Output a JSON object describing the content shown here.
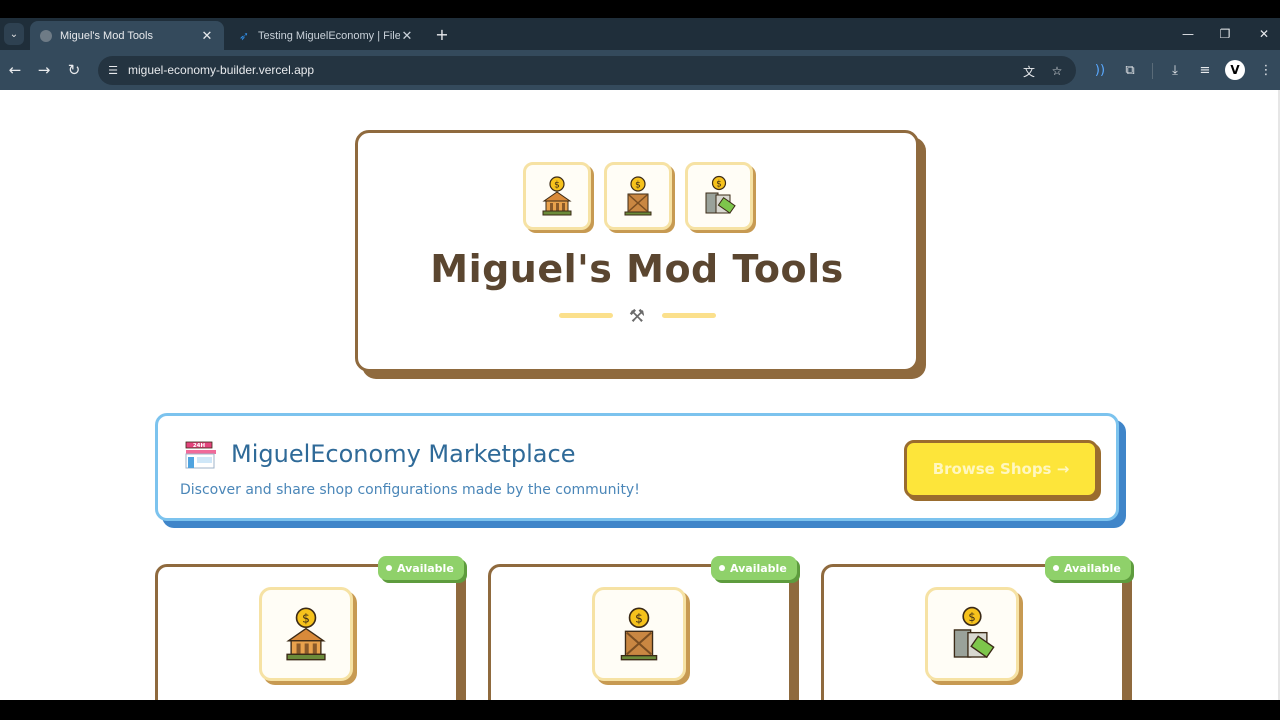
{
  "browser": {
    "tabs": [
      {
        "title": "Miguel's Mod Tools",
        "active": true
      },
      {
        "title": "Testing MiguelEconomy | File M",
        "active": false
      }
    ],
    "url": "miguel-economy-builder.vercel.app",
    "profile_initial": "V"
  },
  "hero": {
    "title": "Miguel's Mod Tools",
    "icons": [
      "bank-coin-icon",
      "crate-coin-icon",
      "atm-cash-icon"
    ],
    "divider_icon": "tools-icon"
  },
  "marketplace": {
    "title": "MiguelEconomy Marketplace",
    "subtitle": "Discover and share shop configurations made by the community!",
    "icon": "24h-store-icon",
    "button_label": "Browse Shops →"
  },
  "cards": [
    {
      "badge": "Available",
      "icon": "bank-coin-icon"
    },
    {
      "badge": "Available",
      "icon": "crate-coin-icon"
    },
    {
      "badge": "Available",
      "icon": "atm-cash-icon"
    }
  ],
  "colors": {
    "brown": "#8f6a3e",
    "title_brown": "#5b4630",
    "blue_border": "#7cc3ee",
    "blue_shadow": "#3f85c9",
    "button_yellow": "#fde53a",
    "badge_green": "#8fd16a"
  }
}
